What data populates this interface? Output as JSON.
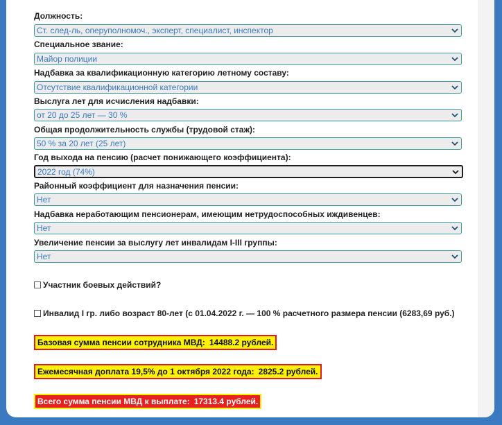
{
  "fields": [
    {
      "label": "Должность:",
      "value": "Ст. след-ль, оперуполномоч., эксперт, специалист, инспектор"
    },
    {
      "label": "Специальное звание:",
      "value": "Майор полиции"
    },
    {
      "label": "Надбавка за квалификационную категорию летному составу:",
      "value": "Отсутствие квалификационной категории"
    },
    {
      "label": "Выслуга лет для исчисления надбавки:",
      "value": "от 20 до 25 лет — 30 %"
    },
    {
      "label": "Общая продолжительность службы (трудовой стаж):",
      "value": "50 % за 20 лет (25 лет)"
    },
    {
      "label": "Год выхода на пенсию (расчет понижающего коэффициента):",
      "value": "2022 год (74%)"
    },
    {
      "label": "Районный коэффициент для назначения пенсии:",
      "value": "Нет"
    },
    {
      "label": "Надбавка неработающим пенсионерам, имеющим нетрудоспособных иждивенцев:",
      "value": "Нет"
    },
    {
      "label": "Увеличение пенсии за выслугу лет инвалидам I-III группы:",
      "value": "Нет"
    }
  ],
  "checkboxes": [
    {
      "label": "Участник боевых действий?",
      "checked": false
    },
    {
      "label": "Инвалид I гр. либо возраст 80-лет (с 01.04.2022 г. — 100 % расчетного размера пенсии (6283,69 руб.)",
      "checked": false
    }
  ],
  "results": {
    "base_label": "Базовая сумма пенсии сотрудника МВД:",
    "base_value": "14488.2 рублей.",
    "extra_label": "Ежемесячная доплата 19,5% до 1 октября 2022 года:",
    "extra_value": "2825.2 рублей.",
    "total_label": "Всего сумма пенсии МВД к выплате:",
    "total_value": "17313.4 рублей."
  },
  "colors": {
    "background": "#3b7ac0",
    "select_border": "#3a9a9a",
    "select_text": "#3b7ac0",
    "highlight_yellow": "#fff200",
    "highlight_red": "#e8201f"
  }
}
